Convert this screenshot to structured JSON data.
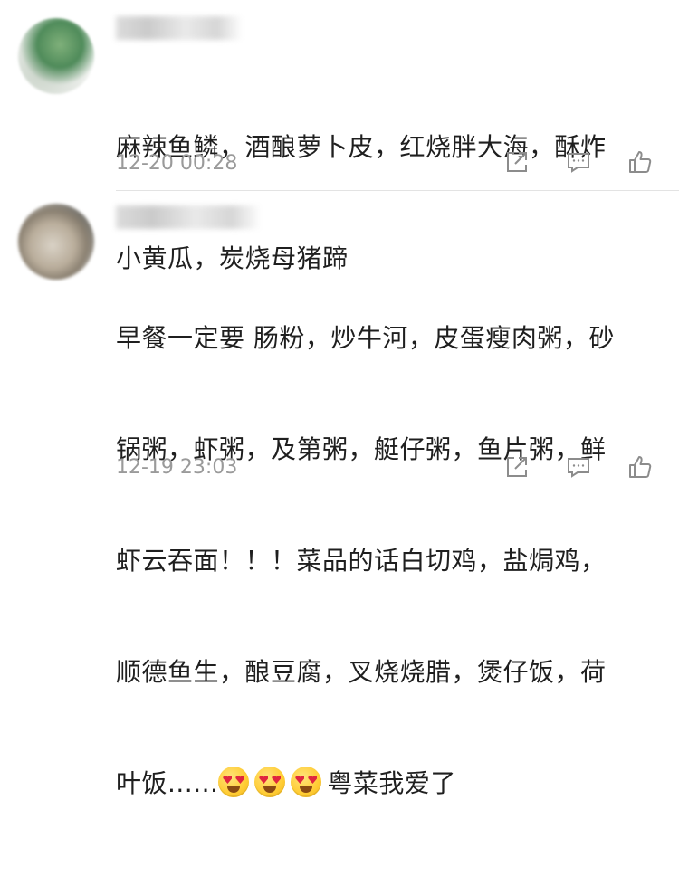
{
  "comments": [
    {
      "text_lines": [
        "麻辣鱼鳞，酒酿萝卜皮，红烧胖大海，酥炸",
        "小黄瓜，炭烧母猪蹄"
      ],
      "timestamp": "12-20 00:28"
    },
    {
      "text_lines": [
        "早餐一定要 肠粉，炒牛河，皮蛋瘦肉粥，砂",
        "锅粥，虾粥，及第粥，艇仔粥，鱼片粥，鲜",
        "虾云吞面！！！菜品的话白切鸡，盐焗鸡，",
        "顺德鱼生，酿豆腐，叉烧烧腊，煲仔饭，荷"
      ],
      "last_line_prefix": "叶饭......",
      "last_line_suffix": "粤菜我爱了",
      "emoji": "heart-eyes-emoji",
      "timestamp": "12-19 23:03"
    }
  ],
  "icons": {
    "share": "share-icon",
    "reply": "comment-icon",
    "like": "thumbs-up-icon"
  },
  "colors": {
    "text": "#1f1f1f",
    "meta": "#9a9a9a",
    "icon": "#8c8c8c",
    "divider": "#e3e3e3"
  }
}
